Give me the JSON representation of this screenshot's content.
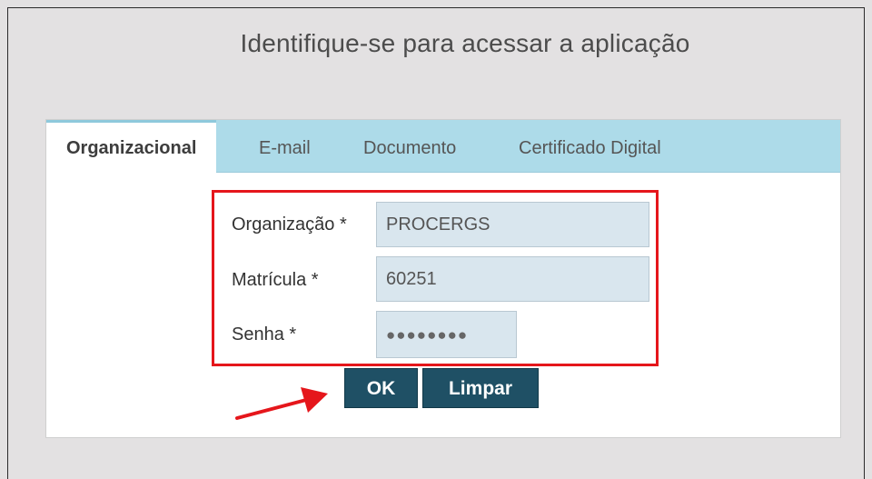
{
  "header": {
    "title": "Identifique-se para acessar a aplicação"
  },
  "tabs": [
    {
      "label": "Organizacional",
      "active": true
    },
    {
      "label": "E-mail",
      "active": false
    },
    {
      "label": "Documento",
      "active": false
    },
    {
      "label": "Certificado Digital",
      "active": false
    }
  ],
  "form": {
    "organizacao": {
      "label": "Organização *",
      "value": "PROCERGS"
    },
    "matricula": {
      "label": "Matrícula *",
      "value": "60251"
    },
    "senha": {
      "label": "Senha *",
      "value": "●●●●●●●●"
    }
  },
  "buttons": {
    "ok": "OK",
    "limpar": "Limpar"
  },
  "colors": {
    "tabbar": "#addbe9",
    "input_bg": "#d9e6ee",
    "button_bg": "#1f5065",
    "highlight": "#e5161b"
  }
}
